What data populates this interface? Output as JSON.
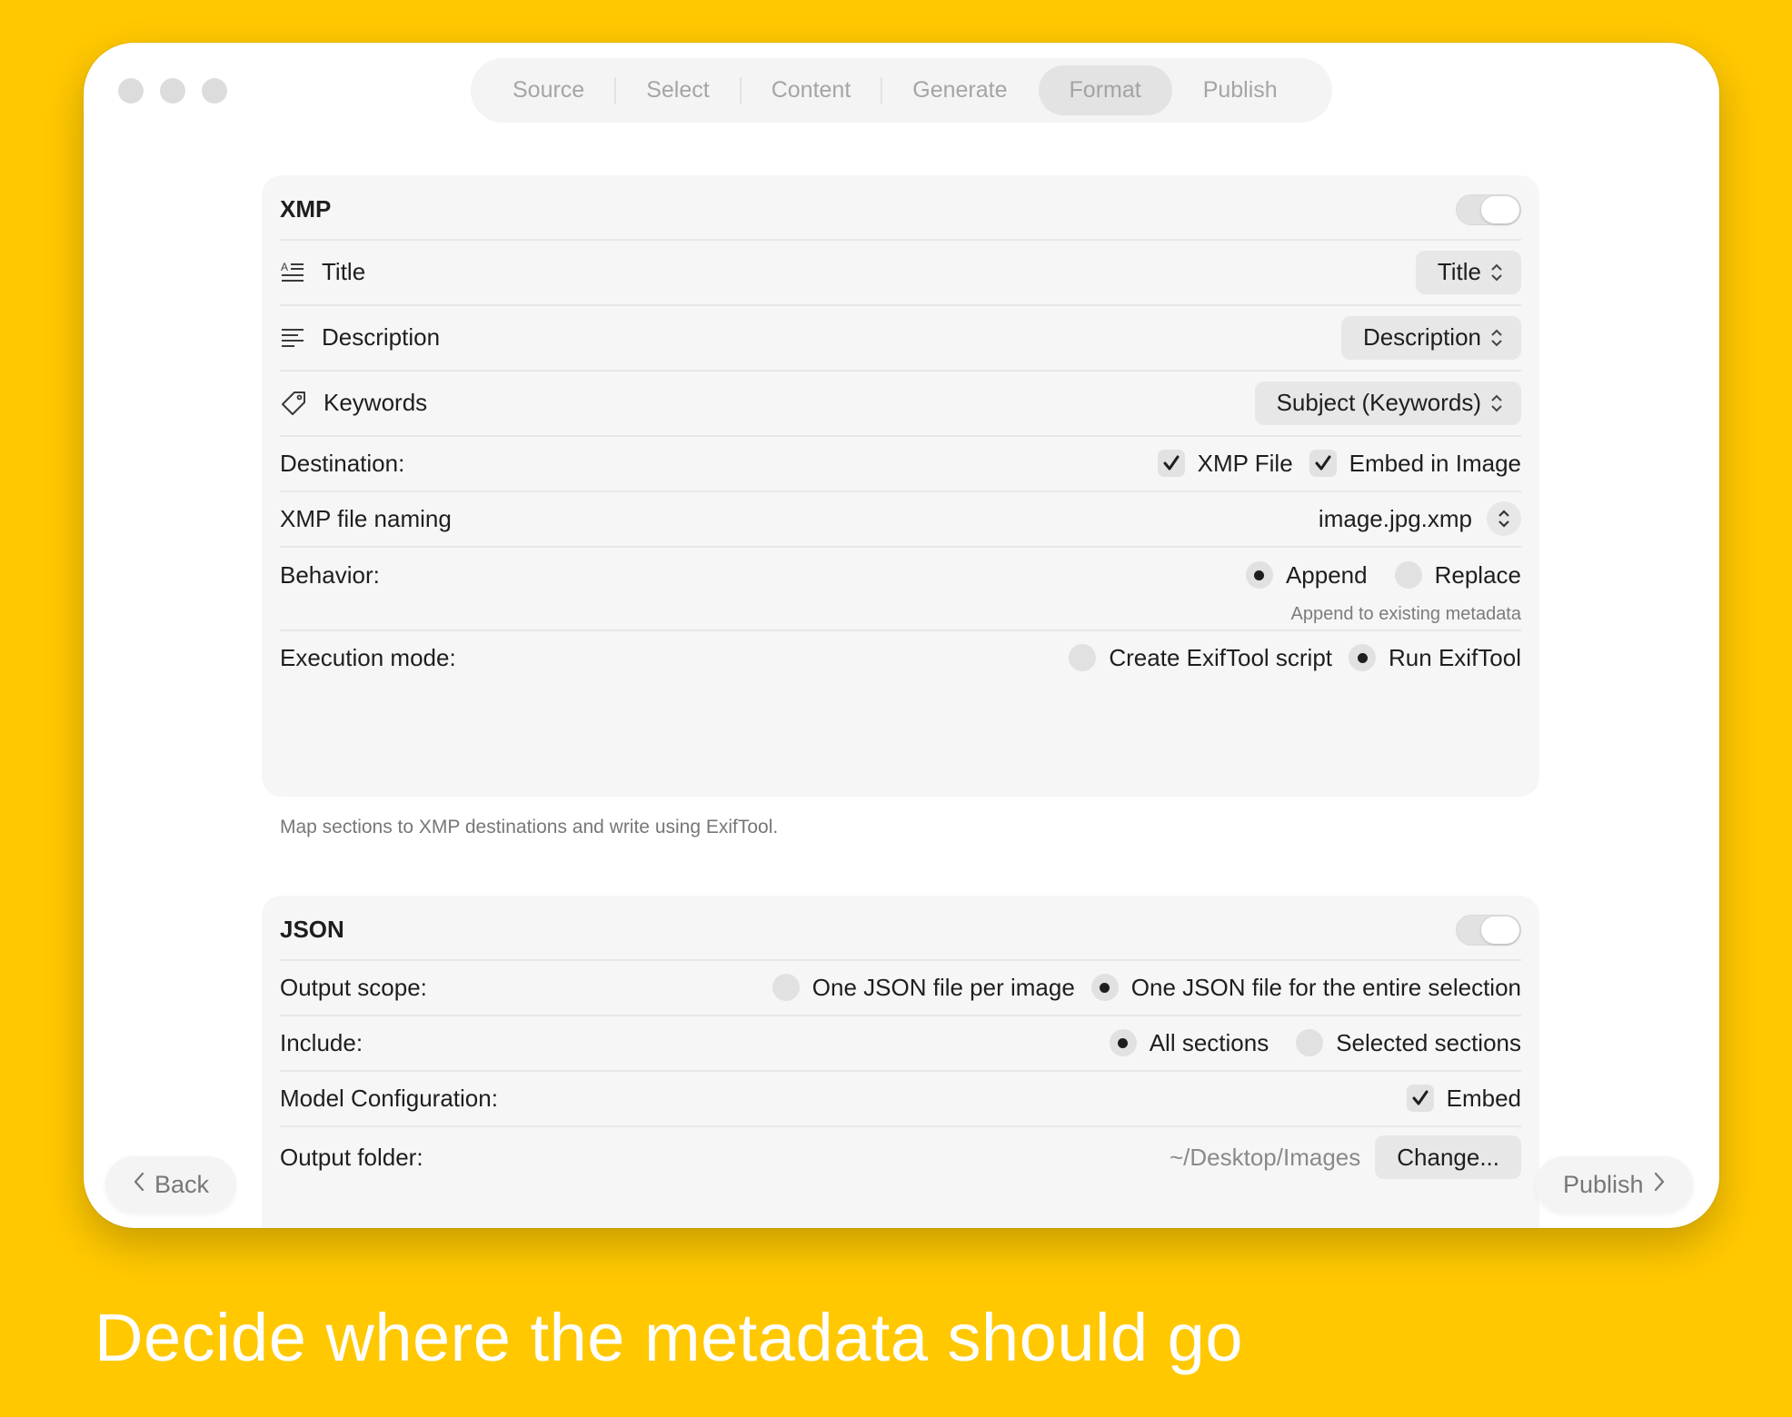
{
  "steps": [
    "Source",
    "Select",
    "Content",
    "Generate",
    "Format",
    "Publish"
  ],
  "active_step": "Format",
  "xmp": {
    "title": "XMP",
    "enabled": true,
    "mappings": [
      {
        "label": "Title",
        "icon": "text-title-icon",
        "value": "Title"
      },
      {
        "label": "Description",
        "icon": "text-align-left-icon",
        "value": "Description"
      },
      {
        "label": "Keywords",
        "icon": "tag-icon",
        "value": "Subject (Keywords)"
      }
    ],
    "destination": {
      "label": "Destination:",
      "options": [
        {
          "label": "XMP File",
          "checked": true
        },
        {
          "label": "Embed in Image",
          "checked": true
        }
      ]
    },
    "naming": {
      "label": "XMP file naming",
      "value": "image.jpg.xmp"
    },
    "behavior": {
      "label": "Behavior:",
      "options": [
        {
          "label": "Append",
          "selected": true
        },
        {
          "label": "Replace",
          "selected": false
        }
      ],
      "hint": "Append to existing metadata"
    },
    "execution": {
      "label": "Execution mode:",
      "options": [
        {
          "label": "Create ExifTool script",
          "selected": false
        },
        {
          "label": "Run ExifTool",
          "selected": true
        }
      ]
    },
    "footnote": "Map sections to XMP destinations and write using ExifTool."
  },
  "json": {
    "title": "JSON",
    "enabled": true,
    "scope": {
      "label": "Output scope:",
      "options": [
        {
          "label": "One JSON file per image",
          "selected": false
        },
        {
          "label": "One JSON file for the entire selection",
          "selected": true
        }
      ]
    },
    "include": {
      "label": "Include:",
      "options": [
        {
          "label": "All sections",
          "selected": true
        },
        {
          "label": "Selected sections",
          "selected": false
        }
      ]
    },
    "model": {
      "label": "Model Configuration:",
      "option": "Embed",
      "checked": true
    },
    "output": {
      "label": "Output folder:",
      "path": "~/Desktop/Images",
      "button": "Change..."
    }
  },
  "nav": {
    "back": "Back",
    "next": "Publish"
  },
  "tagline": "Decide where the metadata should go",
  "colors": {
    "background": "#FFC800",
    "card": "#f6f6f6",
    "control": "#e7e7e7"
  }
}
